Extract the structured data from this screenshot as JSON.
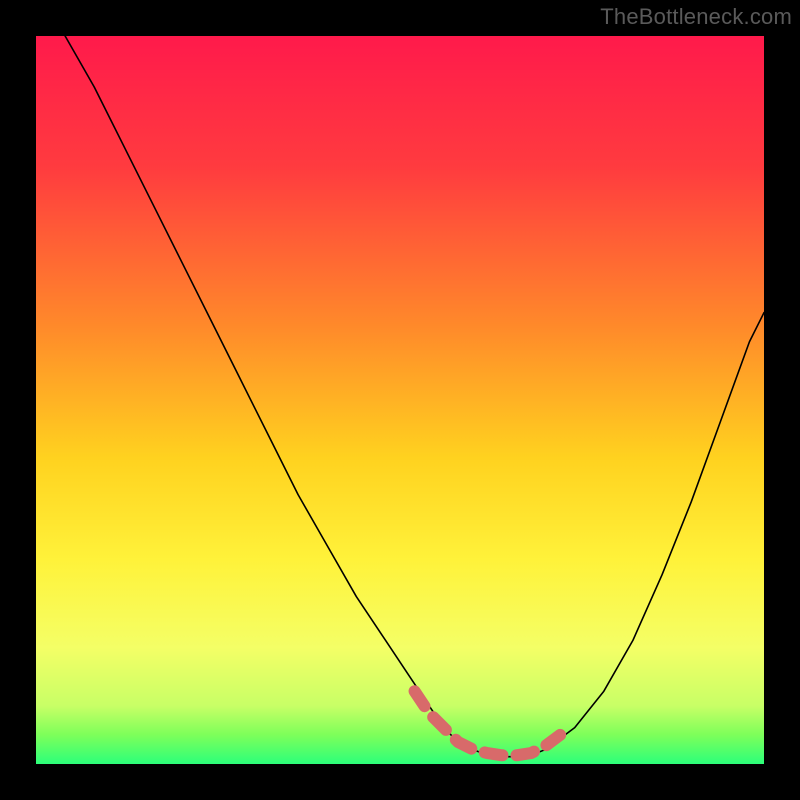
{
  "watermark": "TheBottleneck.com",
  "chart_data": {
    "type": "line",
    "title": "",
    "xlabel": "",
    "ylabel": "",
    "xlim": [
      0,
      100
    ],
    "ylim": [
      0,
      100
    ],
    "gradient_stops": [
      {
        "offset": 0,
        "color": "#ff1a4b"
      },
      {
        "offset": 18,
        "color": "#ff3b3f"
      },
      {
        "offset": 40,
        "color": "#ff8a2a"
      },
      {
        "offset": 58,
        "color": "#ffd21f"
      },
      {
        "offset": 72,
        "color": "#fff23a"
      },
      {
        "offset": 84,
        "color": "#f4ff66"
      },
      {
        "offset": 92,
        "color": "#c8ff66"
      },
      {
        "offset": 96,
        "color": "#7dff5a"
      },
      {
        "offset": 100,
        "color": "#2cff7a"
      }
    ],
    "series": [
      {
        "name": "bottleneck-curve",
        "x": [
          4,
          8,
          12,
          16,
          20,
          24,
          28,
          32,
          36,
          40,
          44,
          48,
          52,
          54,
          56,
          58,
          60,
          62,
          64,
          66,
          68,
          70,
          74,
          78,
          82,
          86,
          90,
          94,
          98,
          100
        ],
        "y": [
          100,
          93,
          85,
          77,
          69,
          61,
          53,
          45,
          37,
          30,
          23,
          17,
          11,
          8,
          5,
          3,
          2,
          1.2,
          1,
          1,
          1.2,
          2,
          5,
          10,
          17,
          26,
          36,
          47,
          58,
          62
        ],
        "color": "#000000"
      }
    ],
    "valley_overlay": {
      "name": "optimal-range",
      "color": "#d86a6a",
      "x": [
        52,
        54,
        56,
        58,
        60,
        62,
        64,
        66,
        68,
        70,
        72
      ],
      "y": [
        10,
        7,
        5,
        3,
        2,
        1.5,
        1.2,
        1.2,
        1.5,
        2.5,
        4
      ]
    }
  }
}
